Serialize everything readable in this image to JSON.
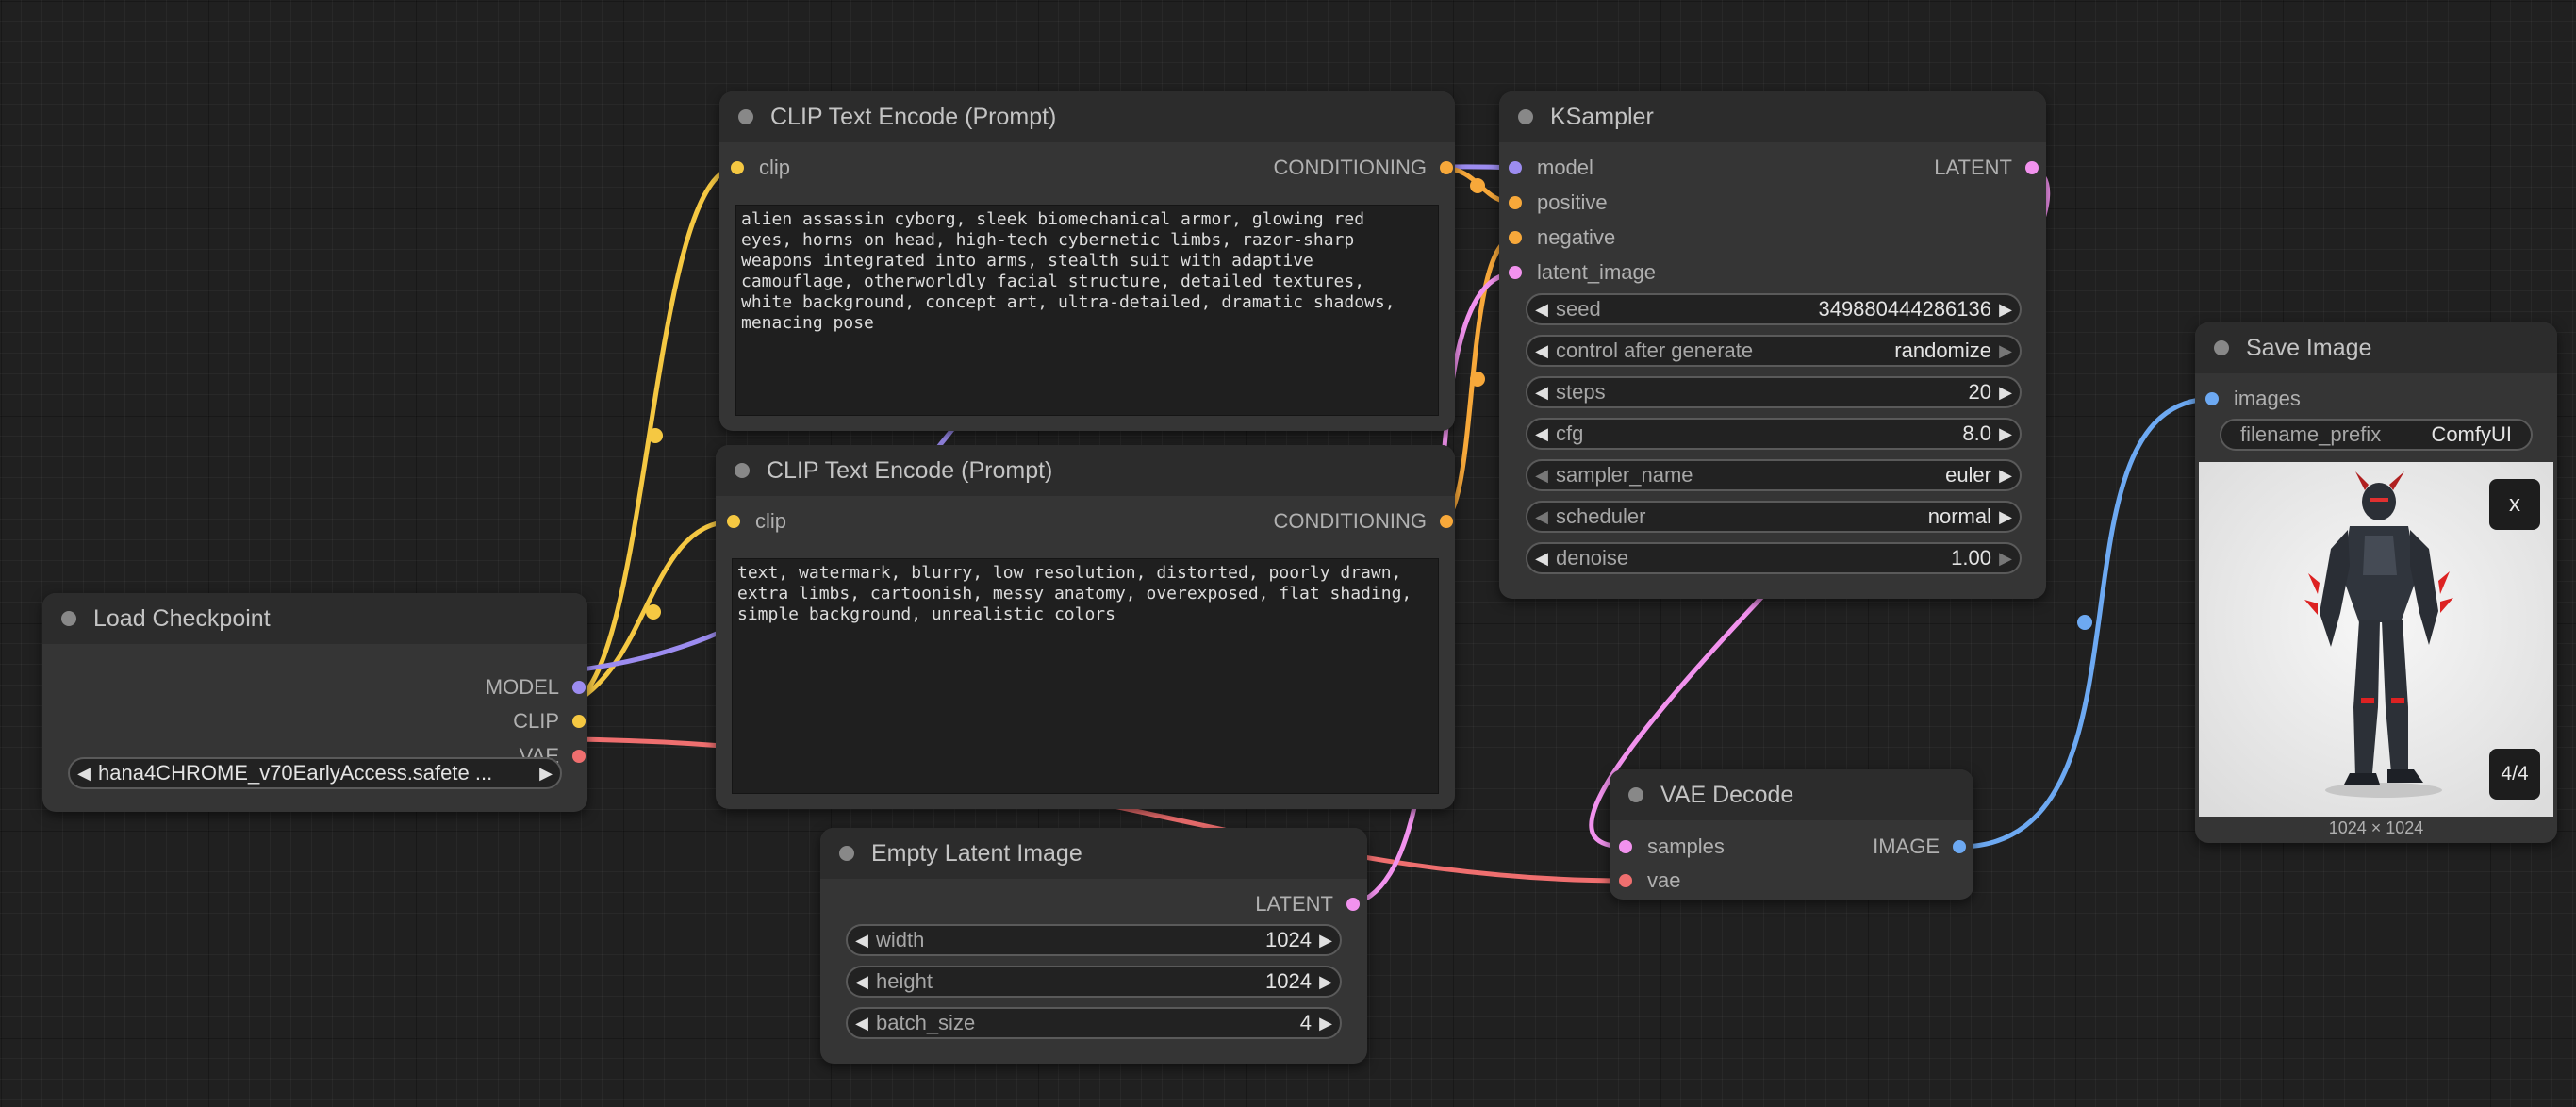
{
  "colors": {
    "model": "#9c8cf0",
    "clip": "#f5c842",
    "vae": "#ef6f6f",
    "conditioning": "#f7a83a",
    "latent": "#f292ee",
    "image": "#6da9f2"
  },
  "load_checkpoint": {
    "title": "Load Checkpoint",
    "outputs": {
      "model": "MODEL",
      "clip": "CLIP",
      "vae": "VAE"
    },
    "ckpt_name": "hana4CHROME_v70EarlyAccess.safete  ..."
  },
  "clip_positive": {
    "title": "CLIP Text Encode (Prompt)",
    "input_clip": "clip",
    "output": "CONDITIONING",
    "text": "alien assassin cyborg, sleek biomechanical armor, glowing red\neyes, horns on head, high-tech cybernetic limbs, razor-sharp\nweapons integrated into arms, stealth suit with adaptive\ncamouflage, otherworldly facial structure, detailed textures,\nwhite background, concept art, ultra-detailed, dramatic shadows,\nmenacing pose"
  },
  "clip_negative": {
    "title": "CLIP Text Encode (Prompt)",
    "input_clip": "clip",
    "output": "CONDITIONING",
    "text": "text, watermark, blurry, low resolution, distorted, poorly drawn,\nextra limbs, cartoonish, messy anatomy, overexposed, flat shading,\nsimple background, unrealistic colors"
  },
  "ksampler": {
    "title": "KSampler",
    "inputs": {
      "model": "model",
      "positive": "positive",
      "negative": "negative",
      "latent_image": "latent_image"
    },
    "output": "LATENT",
    "widgets": {
      "seed": {
        "label": "seed",
        "value": "349880444286136"
      },
      "control": {
        "label": "control after generate",
        "value": "randomize"
      },
      "steps": {
        "label": "steps",
        "value": "20"
      },
      "cfg": {
        "label": "cfg",
        "value": "8.0"
      },
      "sampler_name": {
        "label": "sampler_name",
        "value": "euler"
      },
      "scheduler": {
        "label": "scheduler",
        "value": "normal"
      },
      "denoise": {
        "label": "denoise",
        "value": "1.00"
      }
    }
  },
  "empty_latent": {
    "title": "Empty Latent Image",
    "output": "LATENT",
    "widgets": {
      "width": {
        "label": "width",
        "value": "1024"
      },
      "height": {
        "label": "height",
        "value": "1024"
      },
      "batch_size": {
        "label": "batch_size",
        "value": "4"
      }
    }
  },
  "vae_decode": {
    "title": "VAE Decode",
    "inputs": {
      "samples": "samples",
      "vae": "vae"
    },
    "output": "IMAGE"
  },
  "save_image": {
    "title": "Save Image",
    "input_images": "images",
    "filename_prefix": {
      "label": "filename_prefix",
      "value": "ComfyUI"
    },
    "close_label": "x",
    "counter": "4/4",
    "dimensions": "1024 × 1024"
  }
}
